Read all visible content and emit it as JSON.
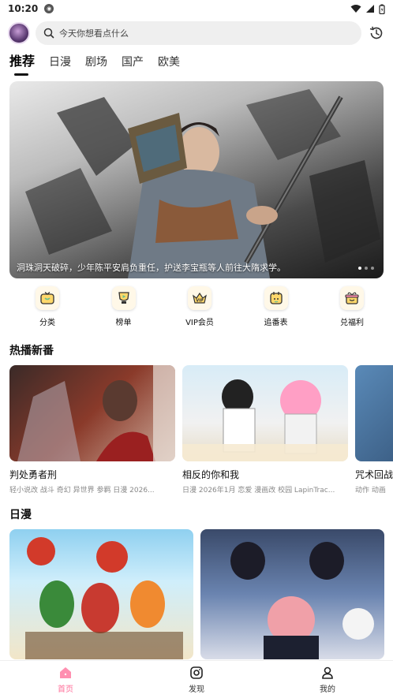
{
  "status_bar": {
    "time": "10:20"
  },
  "search": {
    "placeholder": "今天你想看点什么"
  },
  "tabs": [
    {
      "label": "推荐",
      "active": true
    },
    {
      "label": "日漫",
      "active": false
    },
    {
      "label": "剧场",
      "active": false
    },
    {
      "label": "国产",
      "active": false
    },
    {
      "label": "欧美",
      "active": false
    }
  ],
  "banner": {
    "caption": "洞珠洞天破碎，少年陈平安肩负重任，护送李宝瓶等人前往大隋求学。",
    "slide_count": 3,
    "current_slide": 1
  },
  "shortcuts": [
    {
      "label": "分类",
      "icon": "tv-icon"
    },
    {
      "label": "榜单",
      "icon": "trophy-play-icon"
    },
    {
      "label": "VIP会员",
      "icon": "vip-crown-icon"
    },
    {
      "label": "追番表",
      "icon": "calendar-icon"
    },
    {
      "label": "兑福利",
      "icon": "gift-icon"
    }
  ],
  "sections": {
    "hot": {
      "title": "热播新番",
      "cards": [
        {
          "title": "判处勇者刑",
          "meta": "轻小说改 战斗 奇幻 异世界 参羁 日漫 2026..."
        },
        {
          "title": "相反的你和我",
          "meta": "日漫 2026年1月 恋爱 漫画改 校园 LapinTrac..."
        },
        {
          "title": "咒术回战",
          "meta": "动作 动画"
        }
      ]
    },
    "japanese": {
      "title": "日漫"
    }
  },
  "bottom_nav": [
    {
      "label": "首页",
      "icon": "home-icon",
      "active": true
    },
    {
      "label": "发现",
      "icon": "discover-icon",
      "active": false
    },
    {
      "label": "我的",
      "icon": "profile-icon",
      "active": false
    }
  ],
  "colors": {
    "accent": "#ff6f9a",
    "highlight": "#ffb3cc",
    "search_bg": "#efefef"
  }
}
